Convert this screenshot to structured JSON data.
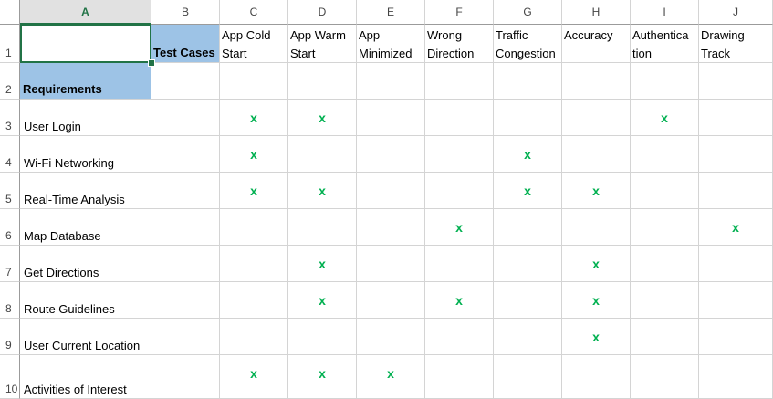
{
  "columns": [
    "A",
    "B",
    "C",
    "D",
    "E",
    "F",
    "G",
    "H",
    "I",
    "J"
  ],
  "rows": [
    "1",
    "2",
    "3",
    "4",
    "5",
    "6",
    "7",
    "8",
    "9",
    "10"
  ],
  "header_row": {
    "b1": "Test Cases",
    "c1": "App Cold\nStart",
    "d1": "App Warm\nStart",
    "e1": "App\nMinimized",
    "f1": "Wrong\nDirection",
    "g1": "Traffic\nCongestion",
    "h1": "Accuracy",
    "i1": "Authentica\ntion",
    "j1": "Drawing\nTrack"
  },
  "a2": "Requirements",
  "requirements": [
    "User Login",
    "Wi-Fi Networking",
    "Real-Time Analysis",
    "Map Database",
    "Get Directions",
    "Route Guidelines",
    "User Current Location",
    "Activities of Interest"
  ],
  "mark_symbol": "x",
  "matrix": [
    [
      "x",
      "x",
      "",
      "",
      "",
      "",
      "x",
      ""
    ],
    [
      "x",
      "",
      "",
      "",
      "x",
      "",
      "",
      ""
    ],
    [
      "x",
      "x",
      "",
      "",
      "x",
      "x",
      "",
      ""
    ],
    [
      "",
      "",
      "",
      "x",
      "",
      "",
      "",
      "x"
    ],
    [
      "",
      "x",
      "",
      "",
      "",
      "x",
      "",
      ""
    ],
    [
      "",
      "x",
      "",
      "x",
      "",
      "x",
      "",
      ""
    ],
    [
      "",
      "",
      "",
      "",
      "",
      "x",
      "",
      ""
    ],
    [
      "x",
      "x",
      "x",
      "",
      "",
      "",
      "",
      ""
    ]
  ],
  "colors": {
    "header_fill": "#9dc3e6",
    "mark": "#00b050",
    "selection": "#217346"
  }
}
